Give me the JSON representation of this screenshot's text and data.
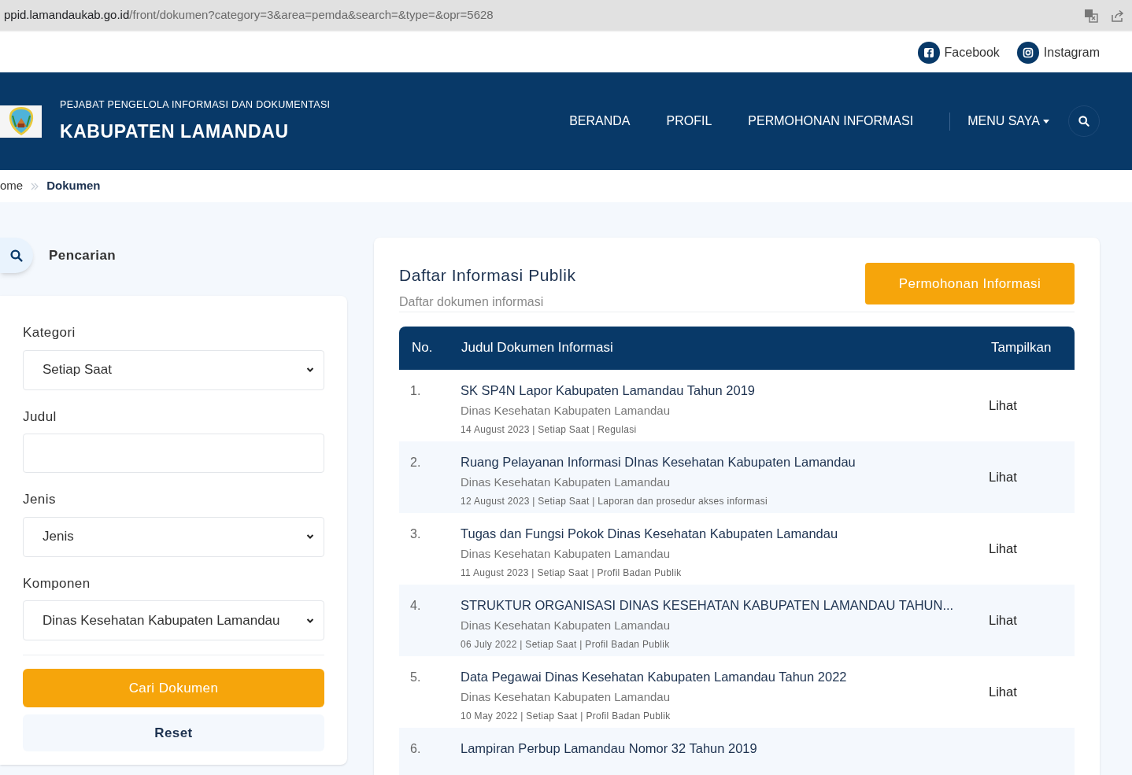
{
  "browser": {
    "url_host": "ppid.lamandaukab.go.id",
    "url_path": "/front/dokumen?category=3&area=pemda&search=&type=&opr=5628"
  },
  "social": [
    {
      "kind": "facebook",
      "label": "Facebook"
    },
    {
      "kind": "instagram",
      "label": "Instagram"
    }
  ],
  "header": {
    "subtitle": "PEJABAT PENGELOLA INFORMASI DAN DOKUMENTASI",
    "title": "KABUPATEN LAMANDAU"
  },
  "nav": [
    {
      "label": "BERANDA",
      "dropdown": false
    },
    {
      "label": "PROFIL",
      "dropdown": false
    },
    {
      "label": "PERMOHONAN INFORMASI",
      "dropdown": false
    },
    {
      "label": "MENU SAYA",
      "dropdown": true
    }
  ],
  "breadcrumb": [
    {
      "label": "ome",
      "selected": false
    },
    {
      "label": "Dokumen",
      "selected": true
    }
  ],
  "search_panel": {
    "title": "Pencarian",
    "fields": [
      {
        "kind": "select",
        "label": "Kategori",
        "value": "Setiap Saat"
      },
      {
        "kind": "text",
        "label": "Judul"
      },
      {
        "kind": "select",
        "label": "Jenis",
        "value": "Jenis"
      },
      {
        "kind": "select",
        "label": "Komponen",
        "value": "Dinas Kesehatan Kabupaten Lamandau"
      }
    ],
    "submit": "Cari Dokumen",
    "reset": "Reset"
  },
  "list": {
    "title": "Daftar Informasi Publik",
    "subtitle": "Daftar dokumen informasi",
    "request_button": "Permohonan Informasi",
    "columns": [
      "No.",
      "Judul Dokumen Informasi",
      "Tampilkan"
    ],
    "rows": [
      {
        "no": "1.",
        "title": "SK SP4N Lapor Kabupaten Lamandau Tahun 2019",
        "agency": "Dinas Kesehatan Kabupaten Lamandau",
        "meta": "14 August 2023 | Setiap Saat | Regulasi",
        "action": "Lihat"
      },
      {
        "no": "2.",
        "title": "Ruang Pelayanan Informasi DInas Kesehatan Kabupaten Lamandau",
        "agency": "Dinas Kesehatan Kabupaten Lamandau",
        "meta": "12 August 2023 | Setiap Saat | Laporan dan prosedur akses informasi",
        "action": "Lihat"
      },
      {
        "no": "3.",
        "title": "Tugas dan Fungsi Pokok Dinas Kesehatan Kabupaten Lamandau",
        "agency": "Dinas Kesehatan Kabupaten Lamandau",
        "meta": "11 August 2023 | Setiap Saat | Profil Badan Publik",
        "action": "Lihat"
      },
      {
        "no": "4.",
        "title": "STRUKTUR ORGANISASI DINAS KESEHATAN KABUPATEN LAMANDAU TAHUN...",
        "agency": "Dinas Kesehatan Kabupaten Lamandau",
        "meta": "06 July 2022 | Setiap Saat | Profil Badan Publik",
        "action": "Lihat"
      },
      {
        "no": "5.",
        "title": "Data Pegawai Dinas Kesehatan Kabupaten Lamandau Tahun 2022",
        "agency": "Dinas Kesehatan Kabupaten Lamandau",
        "meta": "10 May 2022 | Setiap Saat | Profil Badan Publik",
        "action": "Lihat"
      },
      {
        "no": "6.",
        "title": "Lampiran Perbup Lamandau Nomor 32 Tahun 2019"
      }
    ]
  }
}
